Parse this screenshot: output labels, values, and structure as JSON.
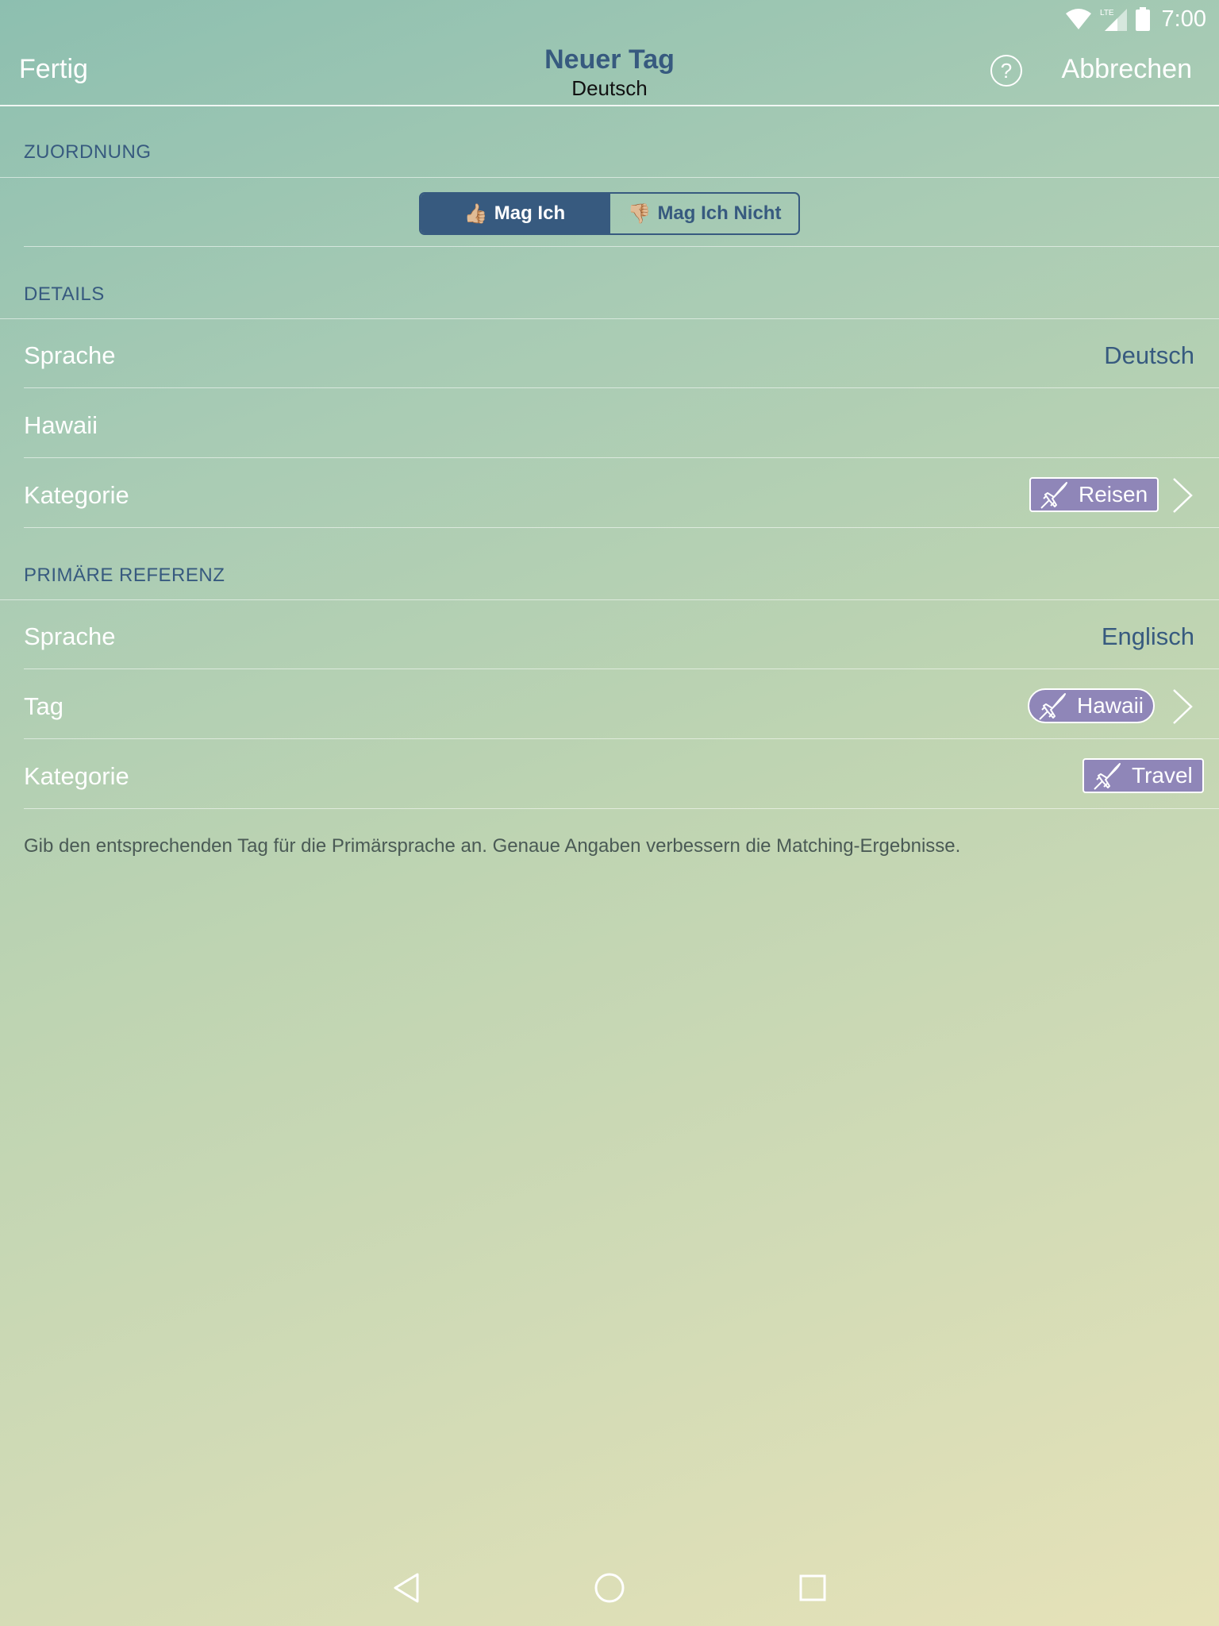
{
  "status_bar": {
    "time": "7:00",
    "network_label": "LTE",
    "icons": [
      "wifi-icon",
      "signal-icon",
      "battery-icon"
    ]
  },
  "nav": {
    "left_label": "Fertig",
    "title": "Neuer Tag",
    "subtitle": "Deutsch",
    "help_label": "?",
    "right_label": "Abbrechen"
  },
  "zuordnung": {
    "header": "ZUORDNUNG",
    "options": [
      {
        "emoji": "👍🏼",
        "label": "Mag Ich",
        "selected": true
      },
      {
        "emoji": "👎🏼",
        "label": "Mag Ich Nicht",
        "selected": false
      }
    ]
  },
  "details": {
    "header": "DETAILS",
    "language_label": "Sprache",
    "language_value": "Deutsch",
    "name_value": "Hawaii",
    "category_label": "Kategorie",
    "category_chip": "Reisen",
    "category_icon": "airplane-icon"
  },
  "primary_reference": {
    "header": "PRIMÄRE REFERENZ",
    "language_label": "Sprache",
    "language_value": "Englisch",
    "tag_label": "Tag",
    "tag_chip": "Hawaii",
    "category_label": "Kategorie",
    "category_chip": "Travel"
  },
  "footer_note": "Gib den entsprechenden Tag für die Primärsprache an. Genaue Angaben verbessern die Matching-Ergebnisse.",
  "colors": {
    "accent": "#375a7f",
    "chip": "#8f86b8",
    "background_start": "#8dbfb0",
    "background_end": "#e6e2b8"
  }
}
